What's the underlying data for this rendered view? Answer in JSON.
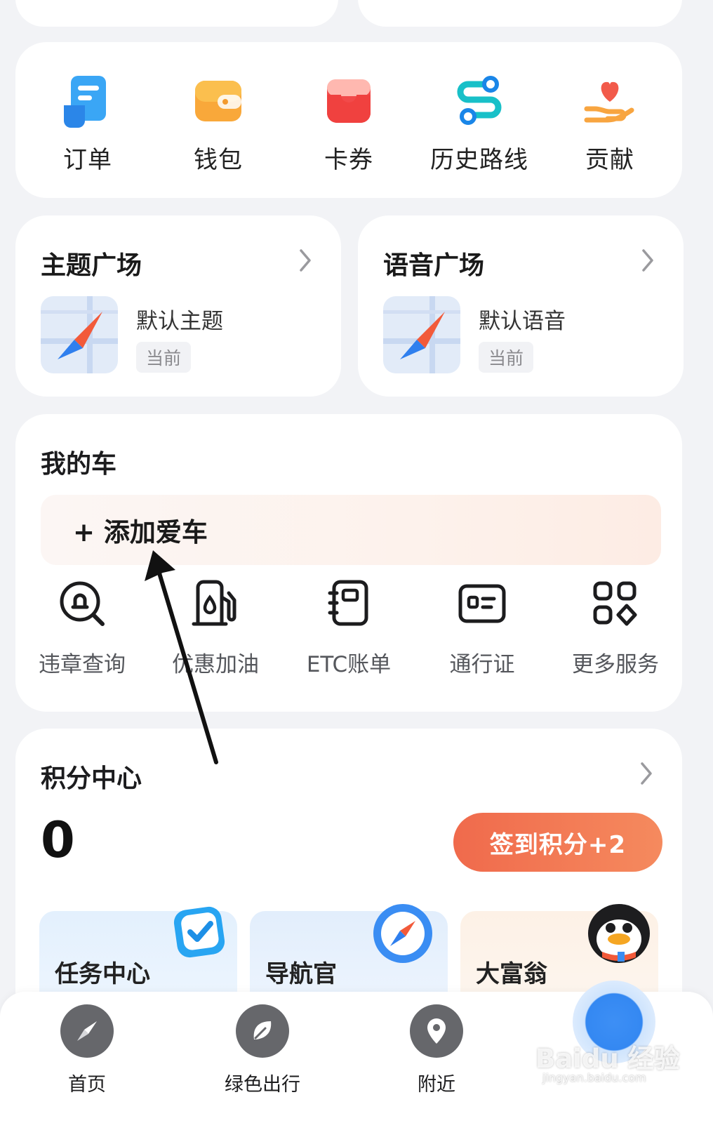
{
  "quick_actions": [
    {
      "label": "订单",
      "icon": "order-icon"
    },
    {
      "label": "钱包",
      "icon": "wallet-icon"
    },
    {
      "label": "卡券",
      "icon": "coupon-icon"
    },
    {
      "label": "历史路线",
      "icon": "route-icon"
    },
    {
      "label": "贡献",
      "icon": "contribute-icon"
    }
  ],
  "theme_square": {
    "title": "主题广场",
    "item_name": "默认主题",
    "badge": "当前"
  },
  "voice_square": {
    "title": "语音广场",
    "item_name": "默认语音",
    "badge": "当前"
  },
  "my_car": {
    "title": "我的车",
    "add_label": "+ 添加爱车",
    "services": [
      {
        "label": "违章查询",
        "icon": "violation-search-icon"
      },
      {
        "label": "优惠加油",
        "icon": "fuel-pump-icon"
      },
      {
        "label": "ETC账单",
        "icon": "etc-bill-icon"
      },
      {
        "label": "通行证",
        "icon": "pass-card-icon"
      },
      {
        "label": "更多服务",
        "icon": "more-services-icon"
      }
    ]
  },
  "points": {
    "title": "积分中心",
    "value": "0",
    "signin_label": "签到积分+2",
    "tiles": [
      {
        "label": "任务中心",
        "icon": "task-check-icon"
      },
      {
        "label": "导航官",
        "icon": "compass-icon"
      },
      {
        "label": "大富翁",
        "icon": "penguin-icon"
      }
    ]
  },
  "tabbar": [
    {
      "label": "首页",
      "icon": "compass-icon"
    },
    {
      "label": "绿色出行",
      "icon": "leaf-icon"
    },
    {
      "label": "附近",
      "icon": "location-pin-icon"
    }
  ],
  "watermark": {
    "text": "Baidu 经验",
    "url": "jingyan.baidu.com"
  },
  "colors": {
    "accent": "#f06a4c",
    "primary_blue": "#3488f2",
    "background": "#f2f3f6"
  }
}
